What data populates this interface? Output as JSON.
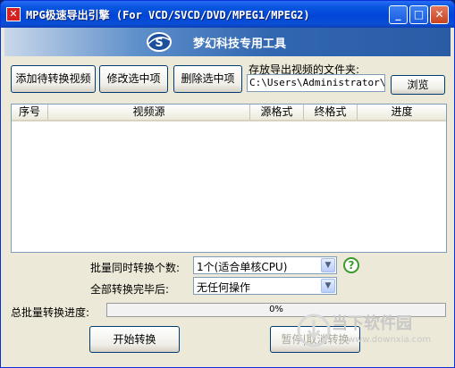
{
  "window": {
    "title": "MPG极速导出引擎 (For VCD/SVCD/DVD/MPEG1/MPEG2)",
    "minimize_label": "_",
    "maximize_label": "□",
    "close_label": "✕"
  },
  "banner": {
    "text": "梦幻科技专用工具",
    "logo_letter": "S"
  },
  "toolbar": {
    "add_label": "添加待转换视频",
    "edit_label": "修改选中项",
    "delete_label": "删除选中项"
  },
  "output_folder": {
    "label": "存放导出视频的文件夹:",
    "path": "C:\\Users\\Administrator\\De",
    "browse_label": "浏览"
  },
  "table": {
    "columns": [
      "序号",
      "视频源",
      "源格式",
      "终格式",
      "进度"
    ],
    "rows": []
  },
  "settings": {
    "batch_count_label": "批量同时转换个数:",
    "batch_count_value": "1个(适合单核CPU)",
    "after_complete_label": "全部转换完毕后:",
    "after_complete_value": "无任何操作",
    "help_glyph": "?"
  },
  "progress": {
    "label": "总批量转换进度:",
    "percent_text": "0%",
    "value": 0
  },
  "actions": {
    "start_label": "开始转换",
    "stop_label": "暂停|取消转换"
  },
  "watermark": {
    "text": "当下软件园",
    "url": "www.downxia.com"
  },
  "colors": {
    "titlebar": "#0045d8",
    "progress_fill": "#3c9a3c",
    "help_icon": "#3a9a2a"
  }
}
